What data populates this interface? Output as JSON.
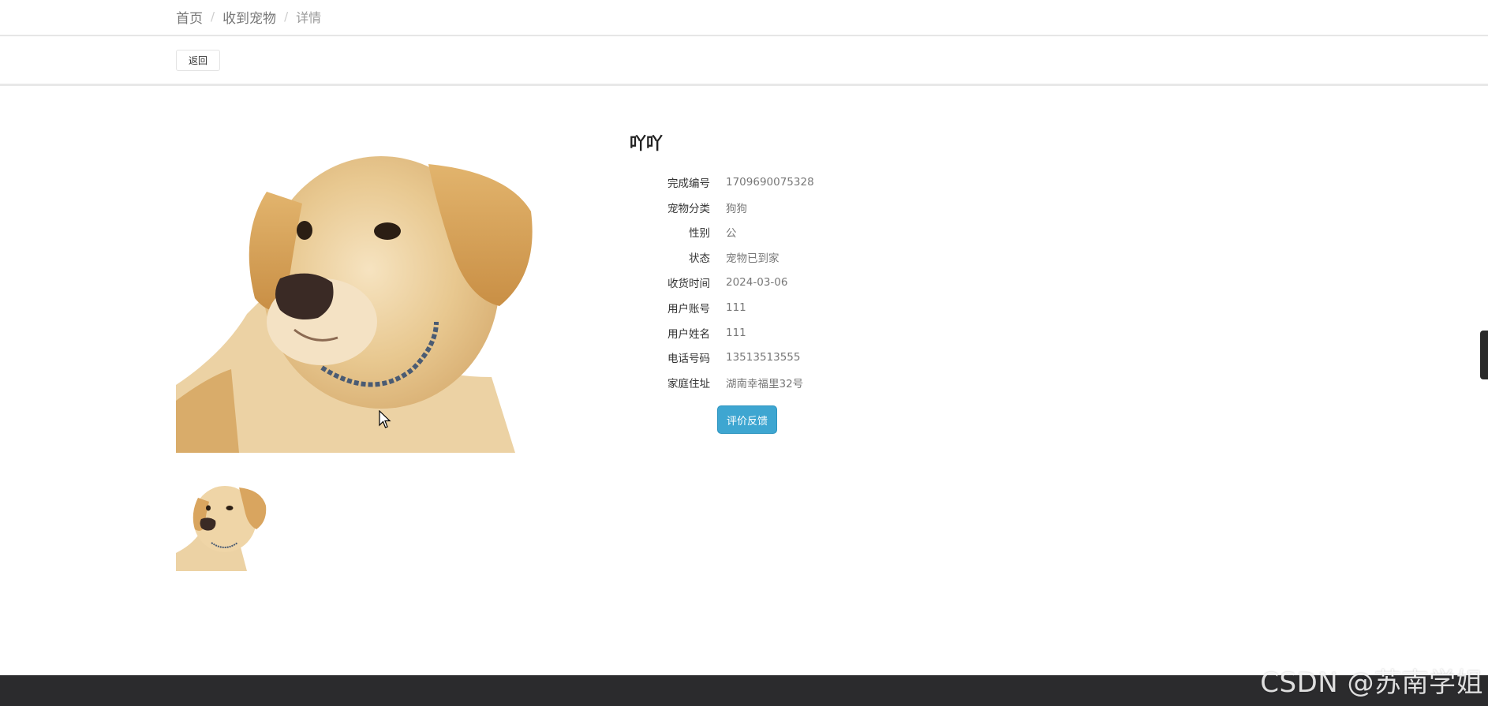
{
  "breadcrumb": {
    "items": [
      "首页",
      "收到宠物"
    ],
    "current": "详情",
    "separator": "/"
  },
  "back_button": {
    "label": "返回"
  },
  "pet": {
    "name": "吖吖",
    "details": [
      {
        "label": "完成编号",
        "value": "1709690075328"
      },
      {
        "label": "宠物分类",
        "value": "狗狗"
      },
      {
        "label": "性别",
        "value": "公"
      },
      {
        "label": "状态",
        "value": "宠物已到家"
      },
      {
        "label": "收货时间",
        "value": "2024-03-06"
      },
      {
        "label": "用户账号",
        "value": "111"
      },
      {
        "label": "用户姓名",
        "value": "111"
      },
      {
        "label": "电话号码",
        "value": "13513513555"
      },
      {
        "label": "家庭住址",
        "value": "湖南幸福里32号"
      }
    ]
  },
  "review_button": {
    "label": "评价反馈"
  },
  "watermark": "CSDN @苏南学姐",
  "colors": {
    "accent": "#3ea6d1",
    "footer": "#2b2b2d",
    "divider": "#e6e6e6"
  }
}
